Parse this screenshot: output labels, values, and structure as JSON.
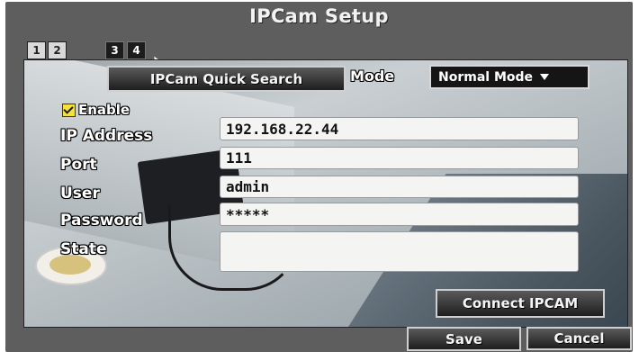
{
  "window": {
    "title": "IPCam Setup"
  },
  "tabs": [
    {
      "label": "1",
      "active": false
    },
    {
      "label": "2",
      "active": false
    },
    {
      "label": "3",
      "active": true
    },
    {
      "label": "4",
      "active": true
    }
  ],
  "toolbar": {
    "quick_search_label": "IPCam Quick Search",
    "mode_label": "Mode",
    "mode_value": "Normal Mode"
  },
  "enable": {
    "label": "Enable",
    "checked": true
  },
  "form": {
    "ip_label": "IP Address",
    "ip_value": "192.168.22.44",
    "port_label": "Port",
    "port_value": "111",
    "user_label": "User",
    "user_value": "admin",
    "password_label": "Password",
    "password_value": "*****",
    "state_label": "State",
    "state_value": ""
  },
  "buttons": {
    "connect": "Connect IPCAM",
    "save": "Save",
    "cancel": "Cancel"
  },
  "colors": {
    "frame": "#5e5e5e",
    "checkbox": "#f6e23a",
    "select_bg": "#151515"
  }
}
